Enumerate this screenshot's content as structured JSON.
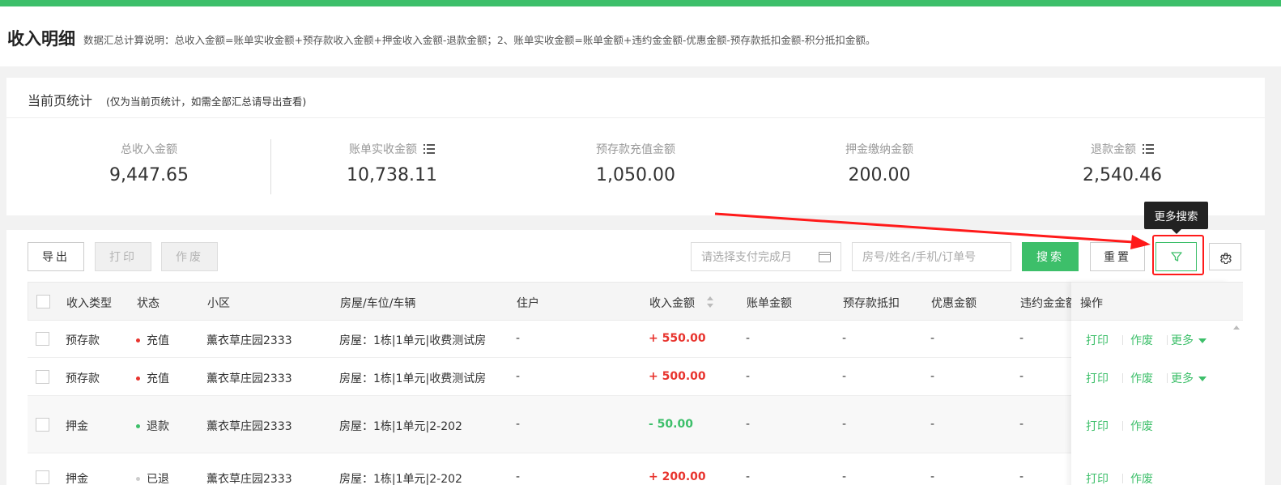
{
  "header": {
    "title": "收入明细",
    "description": "数据汇总计算说明：总收入金额=账单实收金额+预存款收入金额+押金收入金额-退款金额；2、账单实收金额=账单金额+违约金金额-优惠金额-预存款抵扣金额-积分抵扣金额。"
  },
  "stats": {
    "title": "当前页统计",
    "note": "(仅为当前页统计，如需全部汇总请导出查看)",
    "items": [
      {
        "label": "总收入金额",
        "value": "9,447.65"
      },
      {
        "label": "账单实收金额",
        "value": "10,738.11"
      },
      {
        "label": "预存款充值金额",
        "value": "1,050.00"
      },
      {
        "label": "押金缴纳金额",
        "value": "200.00"
      },
      {
        "label": "退款金额",
        "value": "2,540.46"
      }
    ]
  },
  "toolbar": {
    "export": "导出",
    "print": "打印",
    "void": "作废",
    "month_placeholder": "请选择支付完成月",
    "keyword_placeholder": "房号/姓名/手机/订单号",
    "search": "搜索",
    "reset": "重置",
    "more_search_tooltip": "更多搜索"
  },
  "table": {
    "columns": [
      "收入类型",
      "状态",
      "小区",
      "房屋/车位/车辆",
      "住户",
      "收入金额",
      "账单金额",
      "预存款抵扣",
      "优惠金额",
      "违约金金额",
      "操作"
    ],
    "rows": [
      {
        "type": "预存款",
        "status": "充值",
        "status_color": "#e8342e",
        "community": "薰衣草庄园2333",
        "house": "房屋：1栋|1单元|收费测试房",
        "resident": "-",
        "amount": "+ 550.00",
        "amount_kind": "pos",
        "bill": "-",
        "prepay": "-",
        "discount": "-",
        "penalty": "-",
        "ops": [
          "打印",
          "作废",
          "更多"
        ]
      },
      {
        "type": "预存款",
        "status": "充值",
        "status_color": "#e8342e",
        "community": "薰衣草庄园2333",
        "house": "房屋：1栋|1单元|收费测试房",
        "resident": "-",
        "amount": "+ 500.00",
        "amount_kind": "pos",
        "bill": "-",
        "prepay": "-",
        "discount": "-",
        "penalty": "-",
        "ops": [
          "打印",
          "作废",
          "更多"
        ]
      },
      {
        "type": "押金",
        "status": "退款",
        "status_color": "#3dbf6a",
        "community": "薰衣草庄园2333",
        "house": "房屋：1栋|1单元|2-202",
        "resident": "-",
        "amount": "- 50.00",
        "amount_kind": "neg",
        "bill": "-",
        "prepay": "-",
        "discount": "-",
        "penalty": "-",
        "ops": [
          "打印",
          "作废"
        ]
      },
      {
        "type": "押金",
        "status": "已退",
        "status_color": "#cccccc",
        "community": "薰衣草庄园2333",
        "house": "房屋：1栋|1单元|2-202",
        "resident": "-",
        "amount": "+ 200.00",
        "amount_kind": "pos",
        "bill": "-",
        "prepay": "-",
        "discount": "-",
        "penalty": "-",
        "ops": [
          "打印",
          "作废"
        ]
      }
    ]
  },
  "colors": {
    "accent": "#3dbf6a",
    "positive_amount": "#e8342e",
    "negative_amount": "#3dbf6a",
    "annotation": "#ff1a1a"
  },
  "icons": [
    "list-icon",
    "calendar-icon",
    "filter-icon",
    "gear-icon",
    "sort-icon",
    "annotation-arrow"
  ]
}
